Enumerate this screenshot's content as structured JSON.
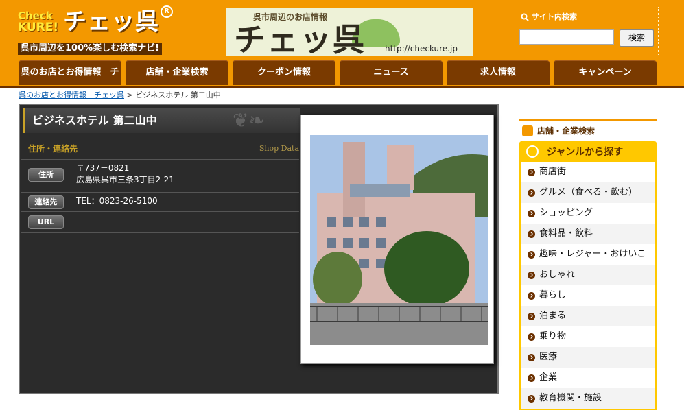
{
  "header": {
    "logo": {
      "check": "Check",
      "kure": "KURE!",
      "name": "チェッ呉",
      "reg": "R",
      "tagline": "呉市周辺を100%楽しむ検索ナビ!"
    },
    "banner": {
      "top_text": "呉市周辺のお店情報",
      "big_text": "チェッ呉",
      "url": "http://checkure.jp"
    },
    "search": {
      "label": "サイト内検索",
      "placeholder": "",
      "button": "検索"
    }
  },
  "nav": {
    "tabs": [
      {
        "label": "呉のお店とお得情報　チェッ呉"
      },
      {
        "label": "店舗・企業検索"
      },
      {
        "label": "クーポン情報"
      },
      {
        "label": "ニュース"
      },
      {
        "label": "求人情報"
      },
      {
        "label": "キャンペーン"
      }
    ]
  },
  "breadcrumb": {
    "link": "呉のお店とお得情報　チェッ呉",
    "separator": ">",
    "current": "ビジネスホテル 第二山中"
  },
  "shop": {
    "name": "ビジネスホテル 第二山中",
    "section_title": "住所・連絡先",
    "section_en": "Shop Data",
    "rows": [
      {
        "label": "住所",
        "line1": "〒737－0821",
        "line2": "広島県呉市三条3丁目2-21"
      },
      {
        "label": "連絡先",
        "line1": "TEL：0823-26-5100"
      },
      {
        "label": "URL",
        "line1": ""
      }
    ]
  },
  "sidebar": {
    "heading": "店舗・企業検索",
    "genre_title": "ジャンルから探す",
    "genres": [
      "商店街",
      "グルメ（食べる・飲む）",
      "ショッピング",
      "食料品・飲料",
      "趣味・レジャー・おけいこ",
      "おしゃれ",
      "暮らし",
      "泊まる",
      "乗り物",
      "医療",
      "企業",
      "教育機関・施設"
    ]
  },
  "colors": {
    "brand_orange": "#f39800",
    "nav_brown": "#7a3a00",
    "gold": "#c9a227",
    "genre_yellow": "#ffc800"
  }
}
